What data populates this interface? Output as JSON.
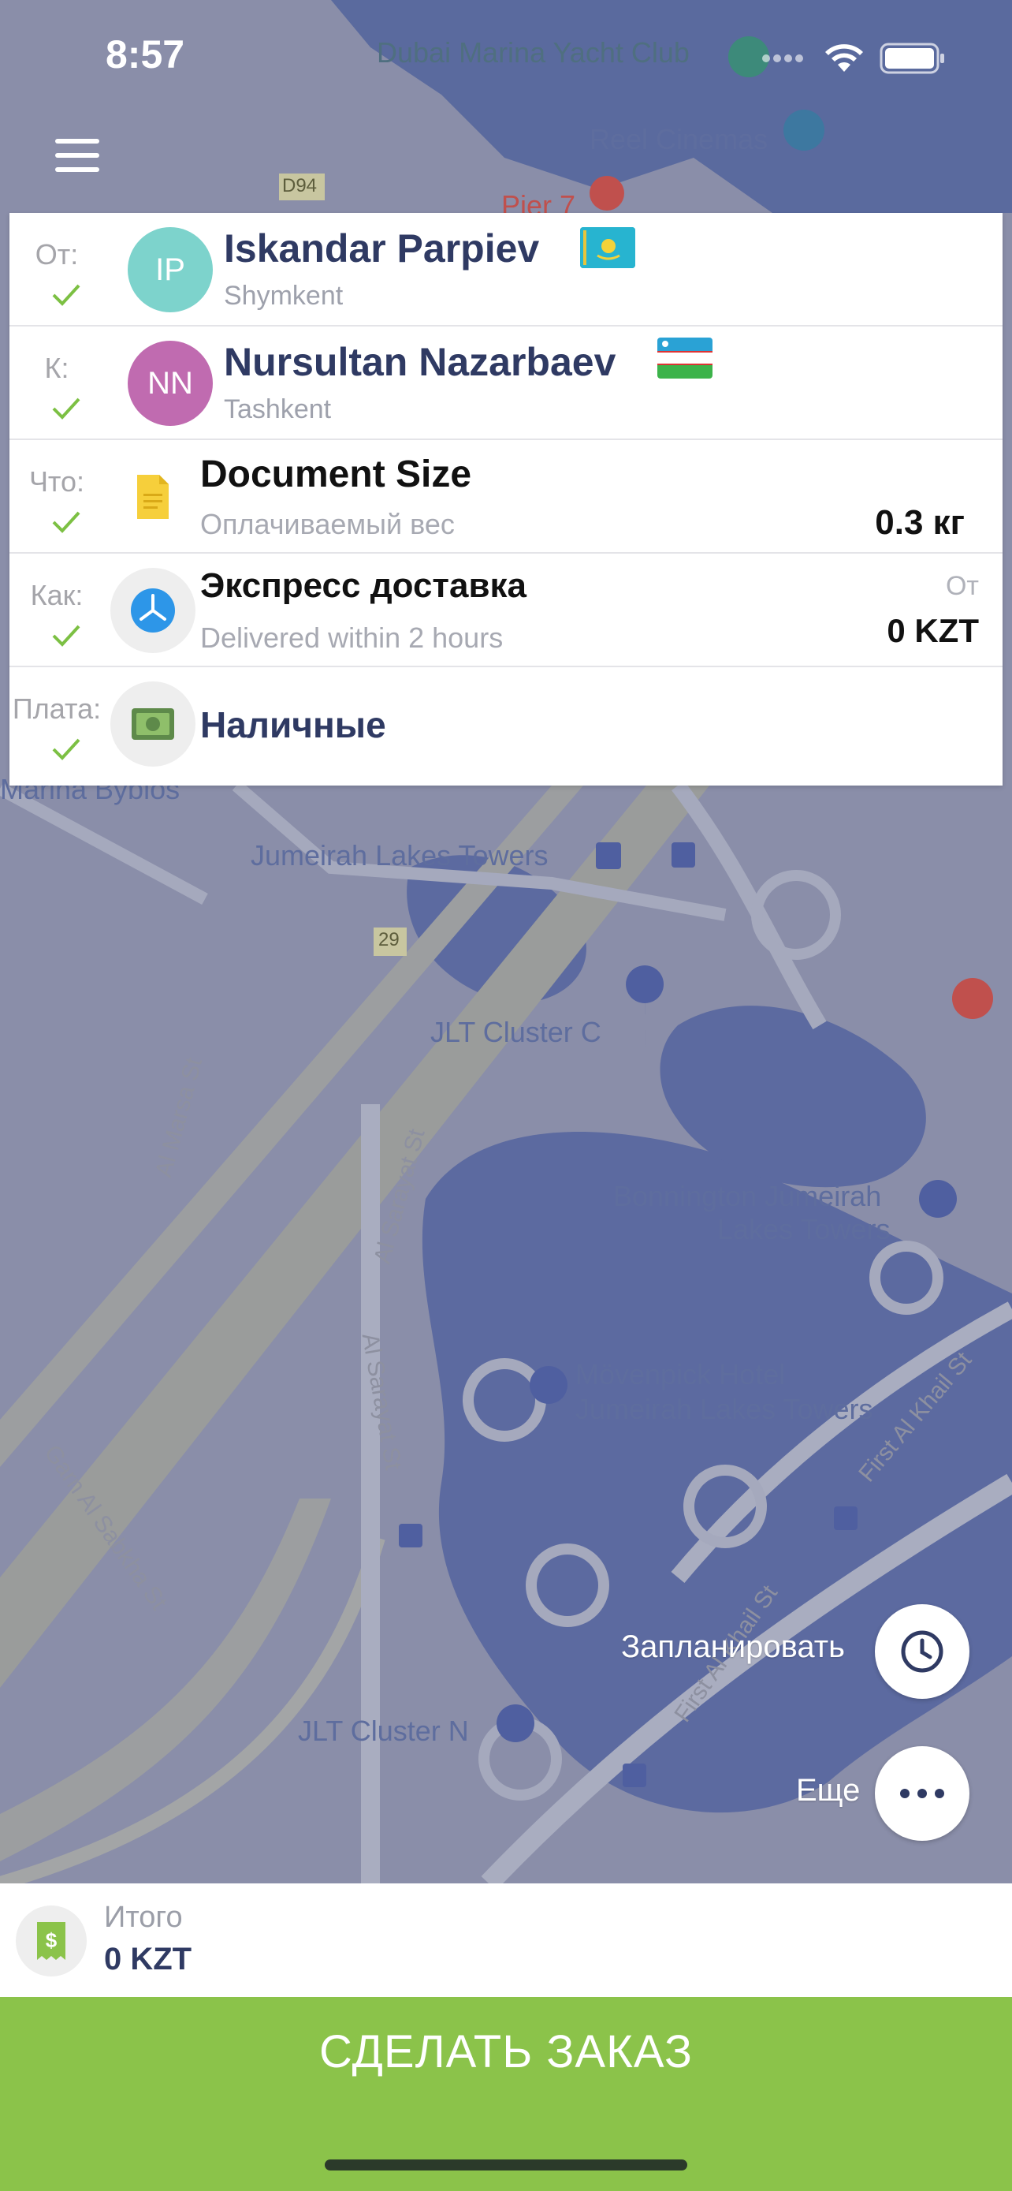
{
  "status_bar": {
    "time": "8:57"
  },
  "map": {
    "labels": {
      "marina_yacht_club": "Dubai Marina Yacht Club",
      "reel_cinemas": "Reel Cinemas",
      "pier7": "Pier 7",
      "marina_byblos": "Marina Byblos",
      "jlt_towers": "Jumeirah Lakes Towers",
      "jlt_cluster_c": "JLT Cluster C",
      "bonnington": "Bonnington Jumeirah",
      "bonnington2": "Lakes Towers",
      "movenpick": "Mövenpick Hotel",
      "movenpick2": "Jumeirah Lakes Towers",
      "jlt_cluster_n": "JLT Cluster N"
    },
    "roads": {
      "d94": "D94",
      "r29": "29",
      "al_marsa": "Al Marsa St",
      "al_sarayat1": "Al Sarayat St",
      "al_sarayat2": "Al Sarayat St",
      "garn": "Garn Al Sabkha St",
      "first_al_khail": "First Al Khail St",
      "first_al_khail2": "First Al Khail St"
    }
  },
  "order": {
    "from": {
      "label": "От:",
      "initials": "IP",
      "name": "Iskandar Parpiev",
      "city": "Shymkent",
      "avatar_color": "#7dd3cc",
      "flag": "kazakhstan-flag"
    },
    "to": {
      "label": "К:",
      "initials": "NN",
      "name": "Nursultan Nazarbaev",
      "city": "Tashkent",
      "avatar_color": "#c06bb0",
      "flag": "uzbekistan-flag"
    },
    "what": {
      "label": "Что:",
      "title": "Document Size",
      "subtitle": "Оплачиваемый вес",
      "weight": "0.3 кг"
    },
    "how": {
      "label": "Как:",
      "title": "Экспресс доставка",
      "subtitle": "Delivered within 2 hours",
      "price_from": "От",
      "price": "0 KZT"
    },
    "payment": {
      "label": "Плата:",
      "title": "Наличные"
    }
  },
  "actions": {
    "schedule_label": "Запланировать",
    "more_label": "Еще"
  },
  "total": {
    "label": "Итого",
    "value": "0 KZT"
  },
  "order_button": {
    "label": "СДЕЛАТЬ ЗАКАЗ"
  },
  "colors": {
    "accent_green": "#8bc34a",
    "check_green": "#7cc043",
    "title_navy": "#2f3a63"
  }
}
